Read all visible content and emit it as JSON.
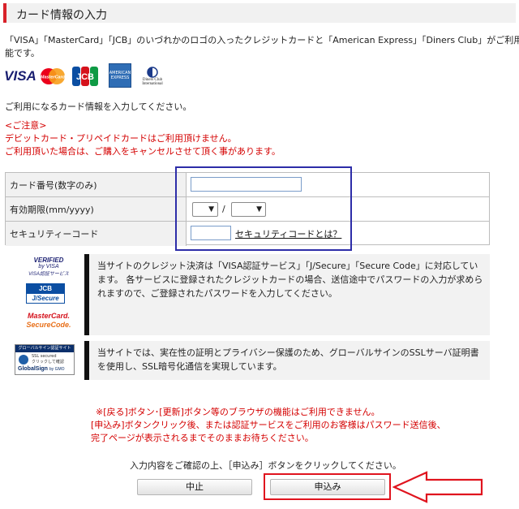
{
  "header": {
    "title": "カード情報の入力"
  },
  "intro": {
    "line1": "「VISA」「MasterCard」「JCB」のいづれかのロゴの入ったクレジットカードと「American Express」「Diners Club」がご利用可",
    "line2": "能です。"
  },
  "brands": {
    "visa": "VISA",
    "mastercard": "MasterCard",
    "jcb": "JCB",
    "amex_line1": "AMERICAN",
    "amex_line2": "EXPRESS",
    "diners_line1": "Diners Club",
    "diners_line2": "International"
  },
  "instruction": "ご利用になるカード情報を入力してください。",
  "caution": {
    "title": "<ご注意>",
    "line1": "デビットカード・プリペイドカードはご利用頂けません。",
    "line2": "ご利用頂いた場合は、ご購入をキャンセルさせて頂く事があります。"
  },
  "form": {
    "card_number_label": "カード番号(数字のみ)",
    "card_number_value": "",
    "expiry_label": "有効期限(mm/yyyy)",
    "expiry_month": "",
    "expiry_separator": "/",
    "expiry_year": "",
    "security_label": "セキュリティーコード",
    "security_value": "",
    "security_link": "セキュリティコードとは？"
  },
  "auth_logos": {
    "verified_line1": "VERIFIED",
    "verified_line2": "by VISA",
    "verified_line3": "VISA認証サービス",
    "jcb_secure_top": "JCB",
    "jcb_secure_bottom": "J/Secure",
    "mc_line1": "MasterCard.",
    "mc_line2": "SecureCode.",
    "gs_header": "グローバルサイン認証サイト",
    "gs_ssl": "SSL secured",
    "gs_click": "クリックして確認",
    "gs_name": "GlobalSign",
    "gs_by": "by GMO"
  },
  "info_3d": "当サイトのクレジット決済は「VISA認証サービス」「J/Secure」「Secure Code」に対応しています。 各サービスに登録されたクレジットカードの場合、送信途中でパスワードの入力が求められますので、ご登録されたパスワードを入力してください。",
  "info_ssl": "当サイトでは、実在性の証明とプライバシー保護のため、グローバルサインのSSLサーバ証明書を使用し、SSL暗号化通信を実現しています。",
  "notes": {
    "line1": "※[戻る]ボタン･[更新]ボタン等のブラウザの機能はご利用できません。",
    "line2": "[申込み]ボタンクリック後、または認証サービスをご利用のお客様はパスワード送信後、",
    "line3": "完了ページが表示されるまでそのままお待ちください。"
  },
  "confirm_text": "入力内容をご確認の上、［申込み］ボタンをクリックしてください。",
  "buttons": {
    "cancel": "中止",
    "submit": "申込み"
  },
  "colors": {
    "accent_red": "#d8222a",
    "highlight_blue": "#2d2da8",
    "highlight_red": "#e0141e"
  }
}
